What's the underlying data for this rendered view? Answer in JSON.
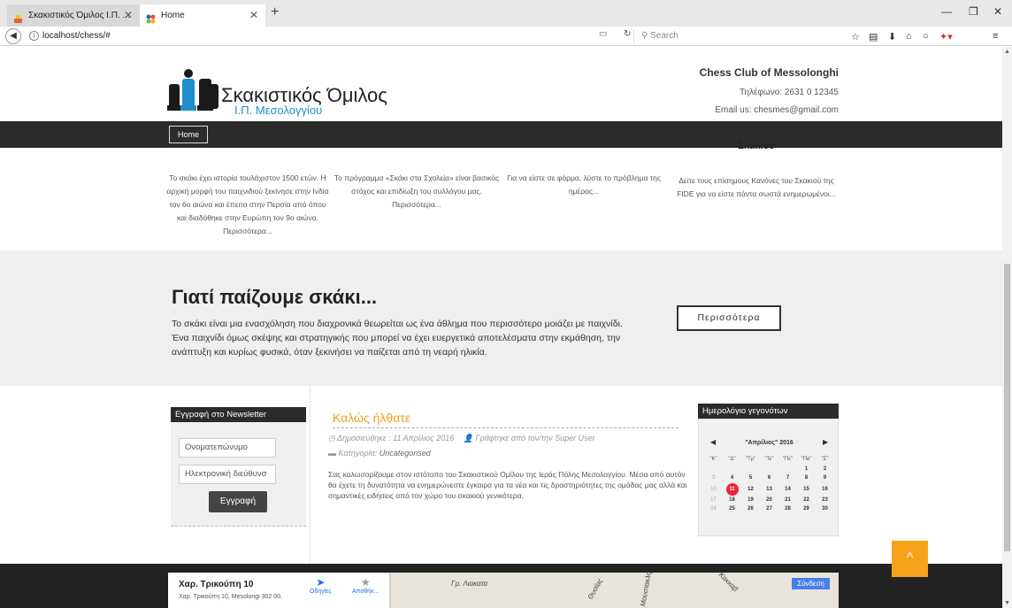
{
  "browser": {
    "tabs": [
      {
        "label": "Σκακιστικός Όμιλος Ι.Π. ..."
      },
      {
        "label": "Home"
      }
    ],
    "url": "localhost/chess/#",
    "search_placeholder": "Search",
    "icons": [
      "star-icon",
      "reading-list-icon",
      "download-icon",
      "home-icon",
      "chat-icon",
      "addon-icon",
      "menu-icon"
    ]
  },
  "header": {
    "logo_title": "Σκακιστικός Όμιλος",
    "logo_subtitle": "Ι.Π. Μεσολογγίου",
    "club_name": "Chess Club of Messolonghi",
    "phone": "Τηλέφωνο: 2631 0 12345",
    "email": "Email us: chesmes@gmail.com"
  },
  "menu": {
    "home": "Home"
  },
  "features": [
    {
      "text": "Το σκάκι έχει ιστορία τουλάχιστον 1500 ετών. Η αρχική μορφή του παιχνιδιού ξεκίνησε στην Ινδία τον 6ο αιώνα και έπειτα στην Περσία από όπου και διαδόθηκε στην Ευρώπη τον 9ο αιώνα. Περισσότερα..."
    },
    {
      "text": "Το πρόγραμμα «Σκάκι στα Σχολεία» είναι βασικός στόχος και επιδίωξη του συλλόγου μας. Περισσότερα..."
    },
    {
      "text": "Για να είστε σε φόρμα, λύστε το πρόβλημα της ημέρας..."
    },
    {
      "heading": "Σκακιού",
      "text": "Δείτε τους επίσημους Κανόνες του Σκακιού της FIDE για να είστε πάντα σωστά ενημερωμένοι..."
    }
  ],
  "why": {
    "title": "Γιατί παίζουμε σκάκι...",
    "text": "Το σκάκι είναι μια ενασχόληση που διαχρονικά θεωρείται ως ένα άθλημα που περισσότερο μοιάζει με παιχνίδι. Ένα παιχνίδι όμως σκέψης και στρατηγικής που μπορεί να έχει ευεργετικά αποτελέσματα στην εκμάθηση, την ανάπτυξη και κυρίως φυσικά, όταν ξεκινήσει να παίζεται από τη νεαρή ηλικία.",
    "more": "Περισσότερα"
  },
  "newsletter": {
    "title": "Εγγραφή στο Newsletter",
    "name_placeholder": "Ονοματεπώνυμο",
    "email_placeholder": "Ηλεκτρονική διεύθυνσ",
    "submit": "Εγγραφή"
  },
  "post": {
    "title": "Καλώς ήλθατε",
    "published": "Δημοσιεύθηκε : 11 Απρίλιος 2016",
    "author": "Γράφτηκε από τον/την Super User",
    "category_label": "Κατηγορία:",
    "category": "Uncategorised",
    "body": "Σας καλωσορίζουμε στον ιστότοπο του Σκακιστικού Ομίλου της Ιεράς Πόλης Μεσολογγίου. Μέσα από αυτόν θα έχετε τη δυνατότητα να ενημερώνεστε έγκαιρα για τα νέα και τις δραστηριότητες της ομάδας μας αλλά και σημαντικές ειδήσεις από τον χώρο του σκακιού γενικότερα."
  },
  "calendar": {
    "title": "Ημερολόγιο γεγονότων",
    "month": "\"Απρίλιος\" 2016",
    "weekdays": [
      "\"Κ\"",
      "\"Δ\"",
      "\"Τρ\"",
      "\"Τε\"",
      "\"Πε\"",
      "\"Πα\"",
      "\"Σ\""
    ],
    "weeks": [
      [
        "",
        "",
        "",
        "",
        "",
        "1",
        "2"
      ],
      [
        "3",
        "4",
        "5",
        "6",
        "7",
        "8",
        "9"
      ],
      [
        "10",
        "11",
        "12",
        "13",
        "14",
        "15",
        "16"
      ],
      [
        "17",
        "18",
        "19",
        "20",
        "21",
        "22",
        "23"
      ],
      [
        "24",
        "25",
        "26",
        "27",
        "28",
        "29",
        "30"
      ]
    ],
    "today": "11"
  },
  "map": {
    "address_title": "Χαρ. Τρικούπη 10",
    "address": "Χαρ. Τρικούπη 10, Mesolongi 302 00,",
    "directions": "Οδηγίες",
    "save": "Αποθήκ...",
    "login": "Σύνδεση",
    "streets": [
      "Γρ. Λιακατα",
      "Θυσίας",
      "Μουστακλή",
      "Κακκαβ"
    ]
  }
}
